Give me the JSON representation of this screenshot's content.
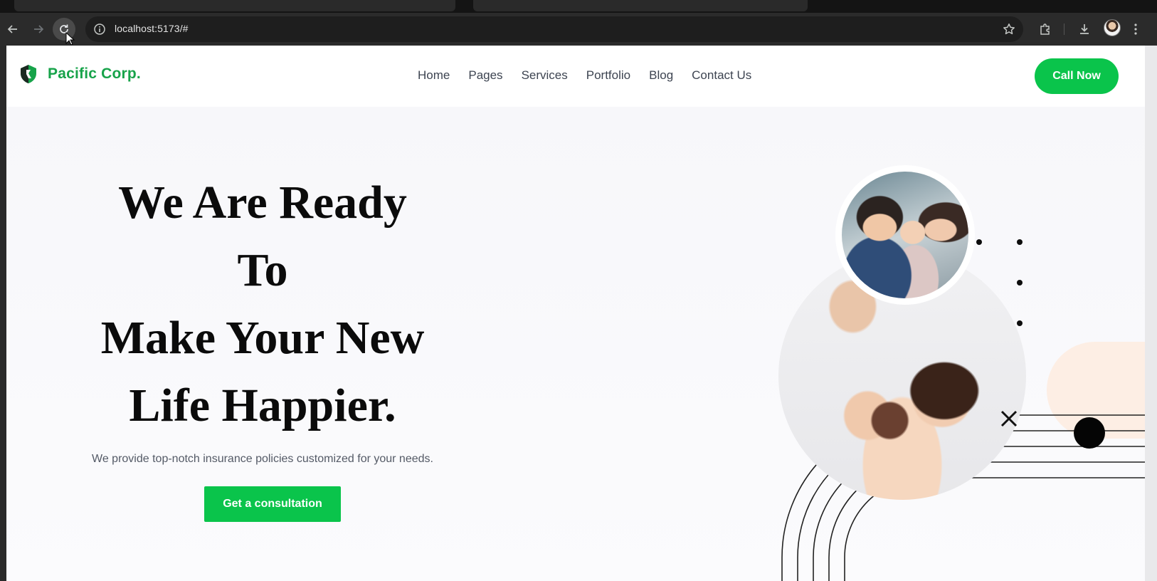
{
  "browser": {
    "url": "localhost:5173/#",
    "icons": [
      "back-arrow-icon",
      "forward-arrow-icon",
      "reload-icon",
      "site-info-icon",
      "bookmark-star-icon",
      "extensions-puzzle-icon",
      "download-icon",
      "profile-avatar",
      "more-vert-icon"
    ]
  },
  "site": {
    "brand": "Pacific Corp.",
    "nav": [
      "Home",
      "Pages",
      "Services",
      "Portfolio",
      "Blog",
      "Contact Us"
    ],
    "cta_label": "Call Now"
  },
  "hero": {
    "headline_lines": [
      "We Are Ready",
      "To",
      "Make Your New",
      "Life Happier."
    ],
    "subtitle": "We provide top-notch insurance policies customized for your needs.",
    "button_label": "Get a consultation"
  },
  "colors": {
    "brand_green": "#17a34a",
    "button_green": "#0ac44b",
    "headline": "#0b0b0b",
    "accent_peach": "#fdeee4"
  }
}
